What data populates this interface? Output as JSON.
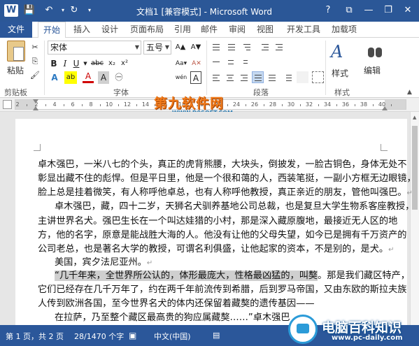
{
  "titlebar": {
    "title": "文档1 [兼容模式] - Microsoft Word",
    "app_icon": "W",
    "qat": {
      "save": "💾",
      "undo": "↶",
      "redo": "↻",
      "customize": "▾"
    },
    "window_buttons": {
      "help": "?",
      "ribbon_options": "⧉",
      "minimize": "—",
      "restore": "❐",
      "close": "✕"
    }
  },
  "tabs": {
    "file": "文件",
    "items": [
      "开始",
      "插入",
      "设计",
      "页面布局",
      "引用",
      "邮件",
      "审阅",
      "视图",
      "开发工具",
      "加载项"
    ]
  },
  "ribbon": {
    "clipboard": {
      "paste": "粘贴",
      "label": "剪贴板"
    },
    "font": {
      "name": "宋体",
      "size": "五号",
      "label": "字体",
      "grow": "A▲",
      "shrink": "A▼",
      "case": "Aa▾",
      "clear": "A✕",
      "pinyin": "wén",
      "border_char": "A",
      "bold": "B",
      "italic": "I",
      "underline": "U",
      "strike": "abc",
      "subscript": "x₂",
      "superscript": "x²",
      "effects": "A",
      "highlight": "ab",
      "font_color": "A",
      "shading": "A",
      "enclose": "㊀"
    },
    "paragraph": {
      "label": "段落"
    },
    "styles": {
      "label": "样式",
      "icon": "A"
    },
    "editing": {
      "label": "编辑"
    }
  },
  "ruler": {
    "numbers": [
      "2",
      "2",
      "4",
      "6",
      "8",
      "10",
      "12",
      "14",
      "16",
      "18",
      "20",
      "22",
      "24",
      "26",
      "28",
      "30",
      "32",
      "34",
      "36",
      "38",
      "40"
    ]
  },
  "watermark_top": {
    "main": "第九软件网",
    "sub": "WWW.D9SOFT.COM"
  },
  "document": {
    "lines": [
      {
        "text": "卓木强巴，一米八七的个头，真正的虎背熊腰，大块头，倒披发，一脸古铜色，身体无处不",
        "mark": ""
      },
      {
        "text": "彰显出藏不住的彪悍。但是平日里，他是一个很和蔼的人，西装笔挺，一副小方框无边眼镜，",
        "mark": ""
      },
      {
        "text": "脸上总是挂着微笑，有人称呼他卓总，也有人称呼他教授，真正亲近的朋友，管他叫强巴。",
        "mark": "↵"
      },
      {
        "text": "卓木强巴，藏，四十二岁，天狮名犬驯养基地公司总裁，也是复旦大学生物系客座教授，",
        "mark": ""
      },
      {
        "text": "主讲世界名犬。强巴生长在一个叫达娃猎的小村，那是深入藏原腹地，最接近无人区的地",
        "mark": ""
      },
      {
        "text": "方，他的名字，原意是能战胜大海的人。他没有让他的父母失望，如今已是拥有千万资产的",
        "mark": ""
      },
      {
        "text": "公司老总，也是著名大学的教授，可谓名利俱盛，让他起家的资本，不是别的，是犬。",
        "mark": "↵"
      },
      {
        "text": "美国，宾夕法尼亚州。",
        "mark": "↵"
      },
      {
        "text_hl": "“几千年来，全世界所公认的，体形最庞大，性格最凶猛的，叫獒",
        "text": "。那是我们藏区特产，",
        "mark": ""
      },
      {
        "text": "它们已经存在几千万年了，约在两千年前流传到希腊，后到罗马帝国，又由东欧的斯拉夫族",
        "mark": ""
      },
      {
        "text": "人传到欧洲各国，至今世界名犬的体内还保留着藏獒的遗传基因——",
        "mark": ""
      },
      {
        "text": "在拉萨，乃至整个藏区最高贵的狗应属藏獒……”卓木强巴",
        "mark": ""
      }
    ]
  },
  "statusbar": {
    "page": "第 1 页，共 2 页",
    "words": "28/1470 个字",
    "lang": "中文(中国)"
  },
  "watermark_bottom": {
    "main": "电脑百科知识",
    "sub": "www.pc-daily.com"
  }
}
